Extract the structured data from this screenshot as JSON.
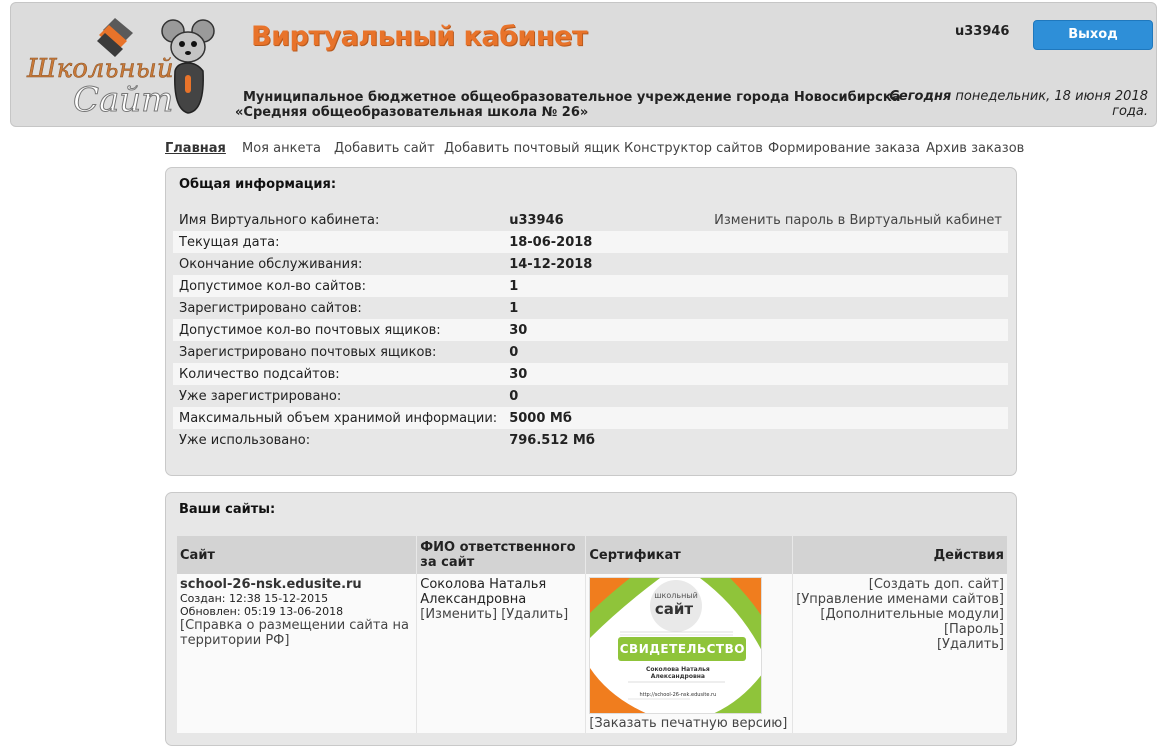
{
  "header": {
    "title": "Виртуальный кабинет",
    "org_name": "Муниципальное бюджетное общеобразовательное учреждение города Новосибирска «Средняя общеобразовательная школа № 26»",
    "user_login": "u33946",
    "logout_label": "Выход",
    "today_label": "Сегодня",
    "today_text": "понедельник, 18 июня 2018 года.",
    "logo": {
      "line1": "Школьный",
      "line2": "Сайт",
      "icon": "mouse-mascot-icon"
    }
  },
  "nav": [
    {
      "label": "Главная",
      "active": true
    },
    {
      "label": "Моя анкета"
    },
    {
      "label": "Добавить сайт"
    },
    {
      "label": "Добавить почтовый ящик"
    },
    {
      "label": "Конструктор сайтов"
    },
    {
      "label": "Формирование заказа"
    },
    {
      "label": "Архив заказов"
    }
  ],
  "info": {
    "title": "Общая информация:",
    "change_password_link": "Изменить пароль в Виртуальный кабинет",
    "rows": [
      {
        "label": "Имя Виртуального кабинета:",
        "value": "u33946"
      },
      {
        "label": "Текущая дата:",
        "value": "18-06-2018"
      },
      {
        "label": "Окончание обслуживания:",
        "value": "14-12-2018"
      },
      {
        "label": "Допустимое кол-во сайтов:",
        "value": "1"
      },
      {
        "label": "Зарегистрировано сайтов:",
        "value": "1"
      },
      {
        "label": "Допустимое кол-во почтовых ящиков:",
        "value": "30"
      },
      {
        "label": "Зарегистрировано почтовых ящиков:",
        "value": "0"
      },
      {
        "label": "Количество подсайтов:",
        "value": "30"
      },
      {
        "label": "Уже зарегистрировано:",
        "value": "0"
      },
      {
        "label": "Максимальный объем хранимой информации:",
        "value": "5000 Мб"
      },
      {
        "label": "Уже использовано:",
        "value": "796.512 Мб"
      }
    ]
  },
  "sites": {
    "title": "Ваши сайты:",
    "columns": {
      "site": "Сайт",
      "person": "ФИО ответственного за сайт",
      "certificate": "Сертификат",
      "actions": "Действия"
    },
    "row": {
      "domain": "school-26-nsk.edusite.ru",
      "created": "Создан: 12:38 15-12-2015",
      "updated": "Обновлен: 05:19 13-06-2018",
      "placement_link": "[Справка о размещении сайта на территории РФ]",
      "person": "Соколова Наталья Александровна",
      "edit_link": "[Изменить]",
      "delete_person_link": "[Удалить]",
      "certificate": {
        "logo_top": "школьный",
        "logo_main": "сайт",
        "heading": "СВИДЕТЕЛЬСТВО",
        "name": "Соколова Наталья Александровна",
        "url": "http://school-26-nsk.edusite.ru"
      },
      "order_print_link": "[Заказать печатную версию]",
      "actions": [
        "[Создать доп. сайт]",
        "[Управление именами сайтов]",
        "[Дополнительные модули]",
        "[Пароль]",
        "[Удалить]"
      ]
    }
  },
  "colors": {
    "accent_orange": "#e8732a",
    "button_blue": "#2e8fd8",
    "panel_bg": "#e7e7e7",
    "header_bg": "#dcdcdc"
  }
}
